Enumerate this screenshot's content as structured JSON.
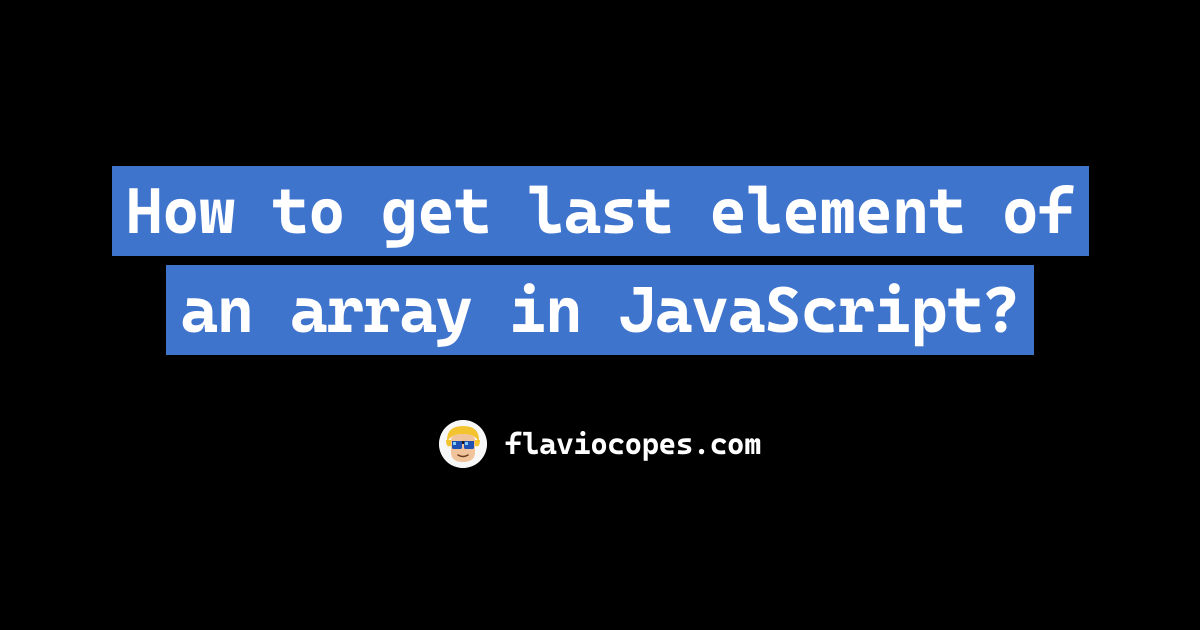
{
  "title": "How to get last element of an array in JavaScript?",
  "credit": {
    "site": "flaviocopes.com"
  },
  "colors": {
    "background": "#000000",
    "highlight": "#3f74cd",
    "text": "#ffffff"
  }
}
